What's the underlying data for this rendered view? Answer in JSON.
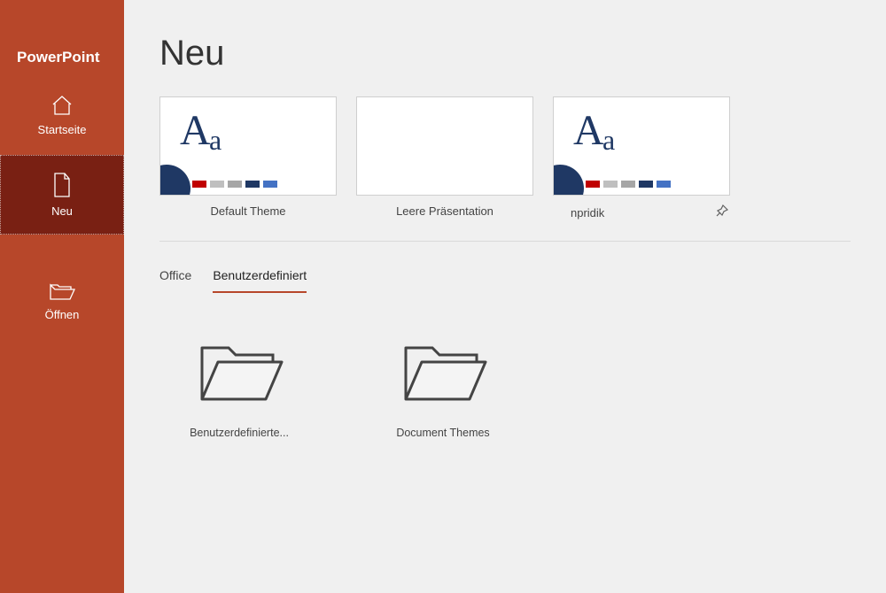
{
  "appName": "PowerPoint",
  "sidebar": {
    "home": "Startseite",
    "new": "Neu",
    "open": "Öffnen"
  },
  "heading": "Neu",
  "templates": [
    {
      "label": "Default Theme"
    },
    {
      "label": "Leere Präsentation"
    },
    {
      "label": "npridik"
    }
  ],
  "tabs": {
    "office": "Office",
    "custom": "Benutzerdefiniert"
  },
  "folders": [
    {
      "label": "Benutzerdefinierte..."
    },
    {
      "label": "Document Themes"
    }
  ]
}
